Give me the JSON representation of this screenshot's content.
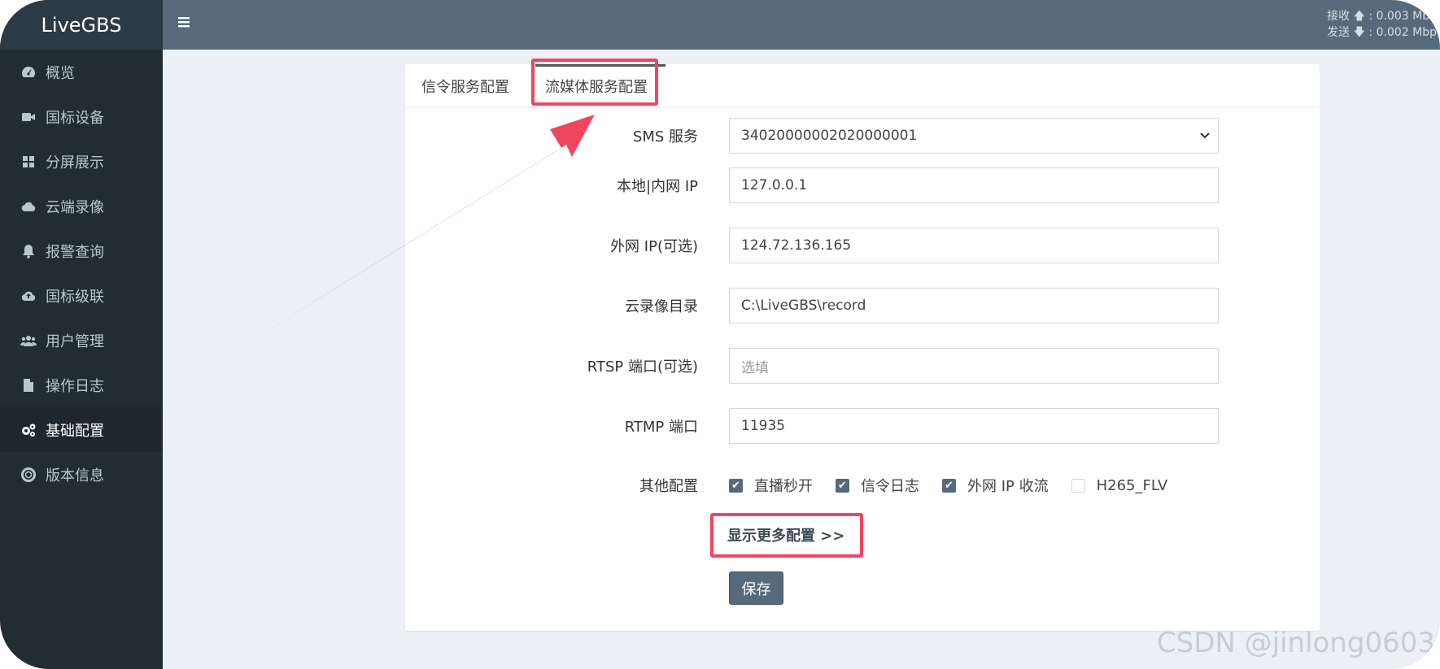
{
  "app": {
    "logo": "LiveGBS"
  },
  "header": {
    "menu_icon": "hamburger-icon",
    "rx_label": "接收",
    "rx_value": "0.003 Mb",
    "tx_label": "发送",
    "tx_value": "0.002 Mbp",
    "separator": ":"
  },
  "sidebar": {
    "items": [
      {
        "label": "概览",
        "icon": "dashboard-icon"
      },
      {
        "label": "国标设备",
        "icon": "video-camera-icon"
      },
      {
        "label": "分屏展示",
        "icon": "grid-icon"
      },
      {
        "label": "云端录像",
        "icon": "cloud-icon"
      },
      {
        "label": "报警查询",
        "icon": "bell-icon"
      },
      {
        "label": "国标级联",
        "icon": "cloud-upload-icon"
      },
      {
        "label": "用户管理",
        "icon": "users-icon"
      },
      {
        "label": "操作日志",
        "icon": "file-icon"
      },
      {
        "label": "基础配置",
        "icon": "cogs-icon",
        "active": true
      },
      {
        "label": "版本信息",
        "icon": "lifebuoy-icon"
      }
    ]
  },
  "tabs": [
    {
      "label": "信令服务配置"
    },
    {
      "label": "流媒体服务配置",
      "active": true
    }
  ],
  "form": {
    "sms_label": "SMS 服务",
    "sms_value": "34020000002020000001",
    "local_ip_label": "本地|内网 IP",
    "local_ip_value": "127.0.0.1",
    "wan_ip_label": "外网 IP(可选)",
    "wan_ip_value": "124.72.136.165",
    "record_dir_label": "云录像目录",
    "record_dir_value": "C:\\LiveGBS\\record",
    "rtsp_label": "RTSP 端口(可选)",
    "rtsp_placeholder": "选填",
    "rtmp_label": "RTMP 端口",
    "rtmp_value": "11935",
    "other_label": "其他配置",
    "options": [
      {
        "label": "直播秒开",
        "checked": true
      },
      {
        "label": "信令日志",
        "checked": true
      },
      {
        "label": "外网 IP 收流",
        "checked": true
      },
      {
        "label": "H265_FLV",
        "checked": false
      }
    ],
    "more_link": "显示更多配置  >>",
    "save_label": "保存"
  },
  "annotation": {
    "color": "#f1455f"
  },
  "watermark": "CSDN @jinlong0603"
}
